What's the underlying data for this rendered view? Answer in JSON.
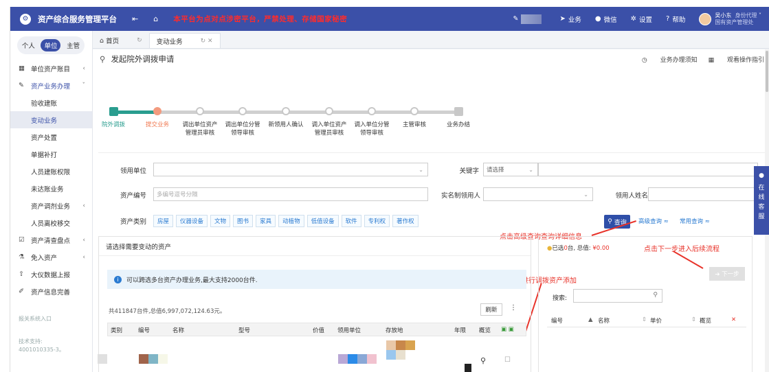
{
  "app": {
    "title": "资产综合服务管理平台",
    "notice": "本平台为点对点涉密平台，严禁处理、存储国家秘密",
    "topbar": {
      "business": "业务",
      "wechat": "微信",
      "settings": "设置",
      "help": "帮助",
      "user_name": "吴小东",
      "user_role": "身份代理",
      "user_dept": "国有资产管理处"
    }
  },
  "sidebar": {
    "scope": [
      "个人",
      "单位",
      "主管"
    ],
    "scope_active": 1,
    "items": [
      {
        "label": "单位资产账目",
        "icon": "grid-icon",
        "arrow": "‹"
      },
      {
        "label": "资产业务办理",
        "icon": "pen-icon",
        "arrow": "ˇ",
        "open": true
      },
      {
        "label": "验收建账",
        "sub": true
      },
      {
        "label": "变动业务",
        "sub": true,
        "active": true
      },
      {
        "label": "资产处置",
        "sub": true
      },
      {
        "label": "单据补打",
        "sub": true
      },
      {
        "label": "人员建账权限",
        "sub": true
      },
      {
        "label": "未达账业务",
        "sub": true
      },
      {
        "label": "资产调剂业务",
        "sub": true,
        "arrow": "‹"
      },
      {
        "label": "人员离校移交",
        "sub": true
      },
      {
        "label": "资产清查盘点",
        "icon": "check-icon",
        "arrow": "‹"
      },
      {
        "label": "免入资产",
        "icon": "flask-icon",
        "arrow": "‹"
      },
      {
        "label": "大仪数据上报",
        "icon": "upload-icon"
      },
      {
        "label": "资产信息完善",
        "icon": "edit-icon"
      }
    ],
    "footer_link": "报关系统入口",
    "footer_support": "技术支持: 4001010335-3。"
  },
  "tabs": [
    {
      "label": "首页",
      "icon": "home-icon"
    },
    {
      "label": "变动业务",
      "active": true
    }
  ],
  "page": {
    "title": "发起院外调拨申请",
    "notice_link": "业务办理须知",
    "guide_link": "观看操作指引"
  },
  "steps": [
    {
      "label": "院外调拨"
    },
    {
      "label": "提交业务"
    },
    {
      "label": "调出单位资产\n管理员审核"
    },
    {
      "label": "调出单位分管\n领导审核"
    },
    {
      "label": "新领用人确认"
    },
    {
      "label": "调入单位资产\n管理员审核"
    },
    {
      "label": "调入单位分管\n领导审核"
    },
    {
      "label": "主管审核"
    },
    {
      "label": "业务办结"
    }
  ],
  "form": {
    "unit_label": "领用单位",
    "keyword_label": "关键字",
    "keyword_select": "请选择",
    "asset_no_label": "资产编号",
    "asset_no_placeholder": "多编号逗号分隔",
    "realname_label": "实名制领用人",
    "user_name_label": "领用人姓名",
    "category_label": "资产类别",
    "categories": [
      "房屋",
      "仪器设备",
      "文物",
      "图书",
      "家具",
      "动植物",
      "低值设备",
      "软件",
      "专利权",
      "著作权"
    ],
    "query_btn": "查询",
    "advanced_link": "高级查询 ≈",
    "common_link": "常用查询 ≈"
  },
  "annotations": {
    "advanced": "点击高级查询查询详细信息",
    "next": "点击下一步进入后续流程",
    "add": "点击进行调拨资产添加"
  },
  "left_panel": {
    "title": "请选择需要变动的资产",
    "info": "可以跨选多台资产办理业务,最大支持2000台件.",
    "summary": "共411847台件,总值6,997,072,124.63元。",
    "refresh": "刷新",
    "columns": [
      "类别",
      "编号",
      "名称",
      "型号",
      "价值",
      "领用单位",
      "存放地",
      "年限",
      "概览"
    ]
  },
  "right_panel": {
    "summary_prefix": "已选",
    "selected_count": "0",
    "summary_mid": "台, 总值: ",
    "total": "¥0.00",
    "next_btn": "➔ 下一步",
    "search_label": "搜索:",
    "columns": [
      "编号",
      "名称",
      "单价",
      "概览"
    ]
  },
  "online_service": "在线客服"
}
